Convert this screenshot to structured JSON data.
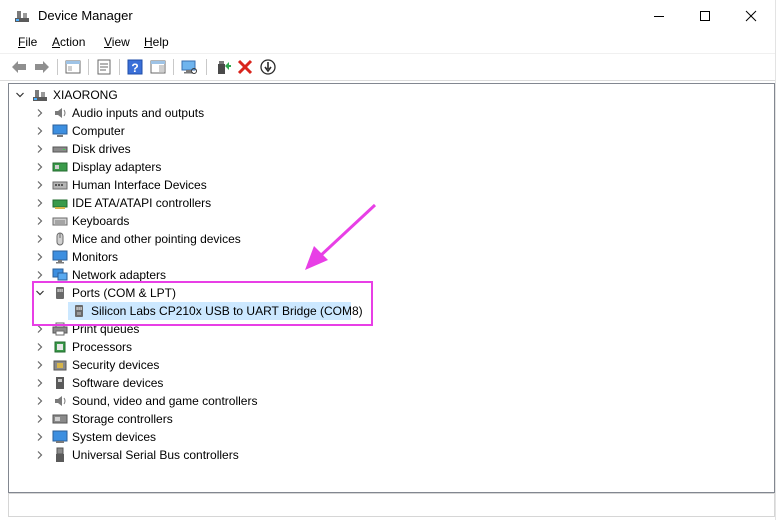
{
  "window": {
    "title": "Device Manager"
  },
  "menu": [
    {
      "key": "F",
      "rest": "ile"
    },
    {
      "key": "A",
      "rest": "ction"
    },
    {
      "key": "V",
      "rest": "iew"
    },
    {
      "key": "H",
      "rest": "elp"
    }
  ],
  "tree": {
    "root": "XIAORONG",
    "categories": [
      {
        "label": "Audio inputs and outputs",
        "icon": "speaker-icon"
      },
      {
        "label": "Computer",
        "icon": "computer-icon"
      },
      {
        "label": "Disk drives",
        "icon": "disk-drive-icon"
      },
      {
        "label": "Display adapters",
        "icon": "display-adapter-icon"
      },
      {
        "label": "Human Interface Devices",
        "icon": "hid-icon"
      },
      {
        "label": "IDE ATA/ATAPI controllers",
        "icon": "ide-controller-icon"
      },
      {
        "label": "Keyboards",
        "icon": "keyboard-icon"
      },
      {
        "label": "Mice and other pointing devices",
        "icon": "mouse-icon"
      },
      {
        "label": "Monitors",
        "icon": "monitor-icon"
      },
      {
        "label": "Network adapters",
        "icon": "network-adapter-icon"
      },
      {
        "label": "Ports (COM & LPT)",
        "icon": "port-icon",
        "expanded": true
      },
      {
        "label": "Print queues",
        "icon": "printer-icon"
      },
      {
        "label": "Processors",
        "icon": "processor-icon"
      },
      {
        "label": "Security devices",
        "icon": "security-device-icon"
      },
      {
        "label": "Software devices",
        "icon": "software-device-icon"
      },
      {
        "label": "Sound, video and game controllers",
        "icon": "sound-icon"
      },
      {
        "label": "Storage controllers",
        "icon": "storage-controller-icon"
      },
      {
        "label": "System devices",
        "icon": "system-device-icon"
      },
      {
        "label": "Universal Serial Bus controllers",
        "icon": "usb-icon"
      }
    ],
    "ports_child": "Silicon Labs CP210x USB to UART Bridge (COM8)"
  },
  "colors": {
    "highlight": "#e83fe6",
    "selection": "#cce8ff"
  }
}
